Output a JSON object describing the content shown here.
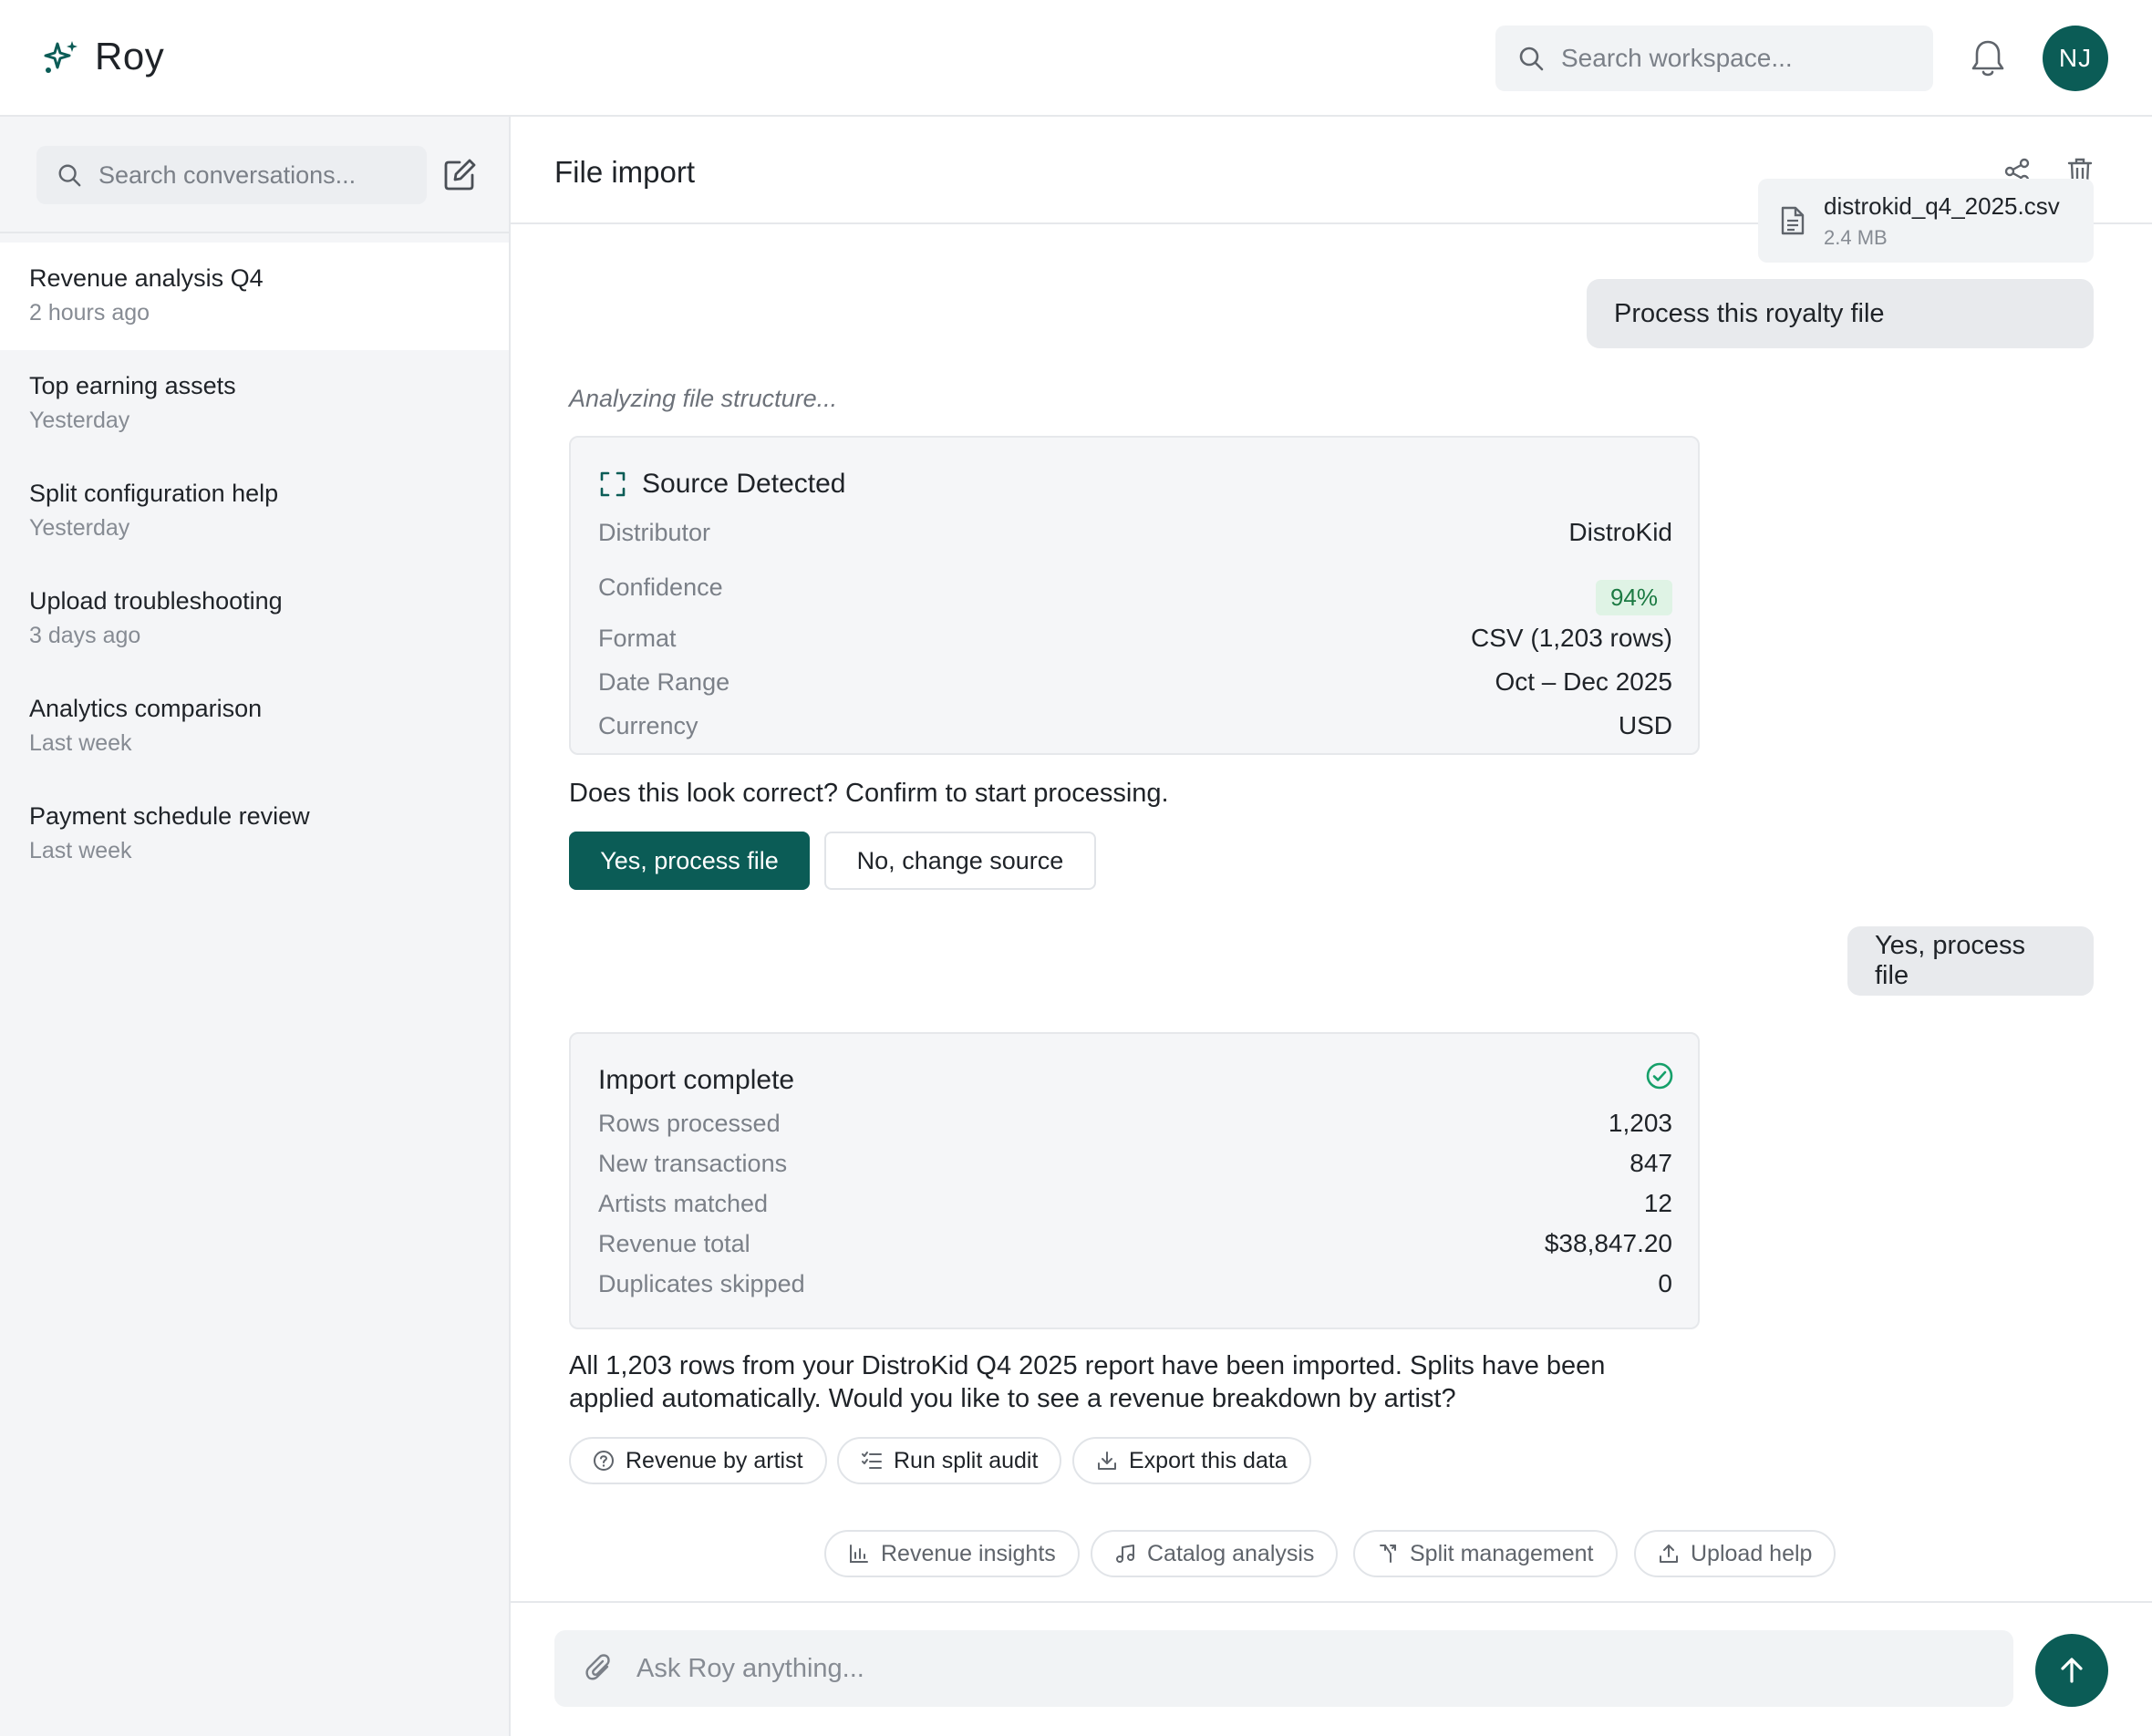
{
  "app": {
    "name": "Roy"
  },
  "header": {
    "search_placeholder": "Search workspace...",
    "avatar_initials": "NJ"
  },
  "sidebar": {
    "search_placeholder": "Search conversations...",
    "conversations": [
      {
        "title": "Revenue analysis Q4",
        "time": "2 hours ago",
        "active": true
      },
      {
        "title": "Top earning assets",
        "time": "Yesterday"
      },
      {
        "title": "Split configuration help",
        "time": "Yesterday"
      },
      {
        "title": "Upload troubleshooting",
        "time": "3 days ago"
      },
      {
        "title": "Analytics comparison",
        "time": "Last week"
      },
      {
        "title": "Payment schedule review",
        "time": "Last week"
      }
    ]
  },
  "chat": {
    "title": "File import",
    "file": {
      "name": "distrokid_q4_2025.csv",
      "size": "2.4 MB"
    },
    "user_message_1": "Process this royalty file",
    "analyzing": "Analyzing file structure...",
    "source_card": {
      "title": "Source Detected",
      "rows": [
        {
          "label": "Distributor",
          "value": "DistroKid"
        },
        {
          "label": "Confidence",
          "value": "94%"
        },
        {
          "label": "Format",
          "value": "CSV (1,203 rows)"
        },
        {
          "label": "Date Range",
          "value": "Oct – Dec 2025"
        },
        {
          "label": "Currency",
          "value": "USD"
        }
      ]
    },
    "question": "Does this look correct? Confirm to start processing.",
    "confirm_label": "Yes, process file",
    "change_label": "No, change source",
    "user_message_2": "Yes, process file",
    "import_card": {
      "title": "Import complete",
      "rows": [
        {
          "label": "Rows processed",
          "value": "1,203"
        },
        {
          "label": "New transactions",
          "value": "847"
        },
        {
          "label": "Artists matched",
          "value": "12"
        },
        {
          "label": "Revenue total",
          "value": "$38,847.20"
        },
        {
          "label": "Duplicates skipped",
          "value": "0"
        }
      ]
    },
    "summary": "All 1,203 rows from your DistroKid Q4 2025 report have been imported. Splits have been applied automatically. Would you like to see a revenue breakdown by artist?",
    "actions": [
      "Revenue by artist",
      "Run split audit",
      "Export this data"
    ],
    "suggestions": [
      "Revenue insights",
      "Catalog analysis",
      "Split management",
      "Upload help"
    ],
    "composer_placeholder": "Ask Roy anything..."
  },
  "colors": {
    "brand": "#0b5c56",
    "success": "#1c7a43",
    "success_bg": "#dff3e5"
  }
}
